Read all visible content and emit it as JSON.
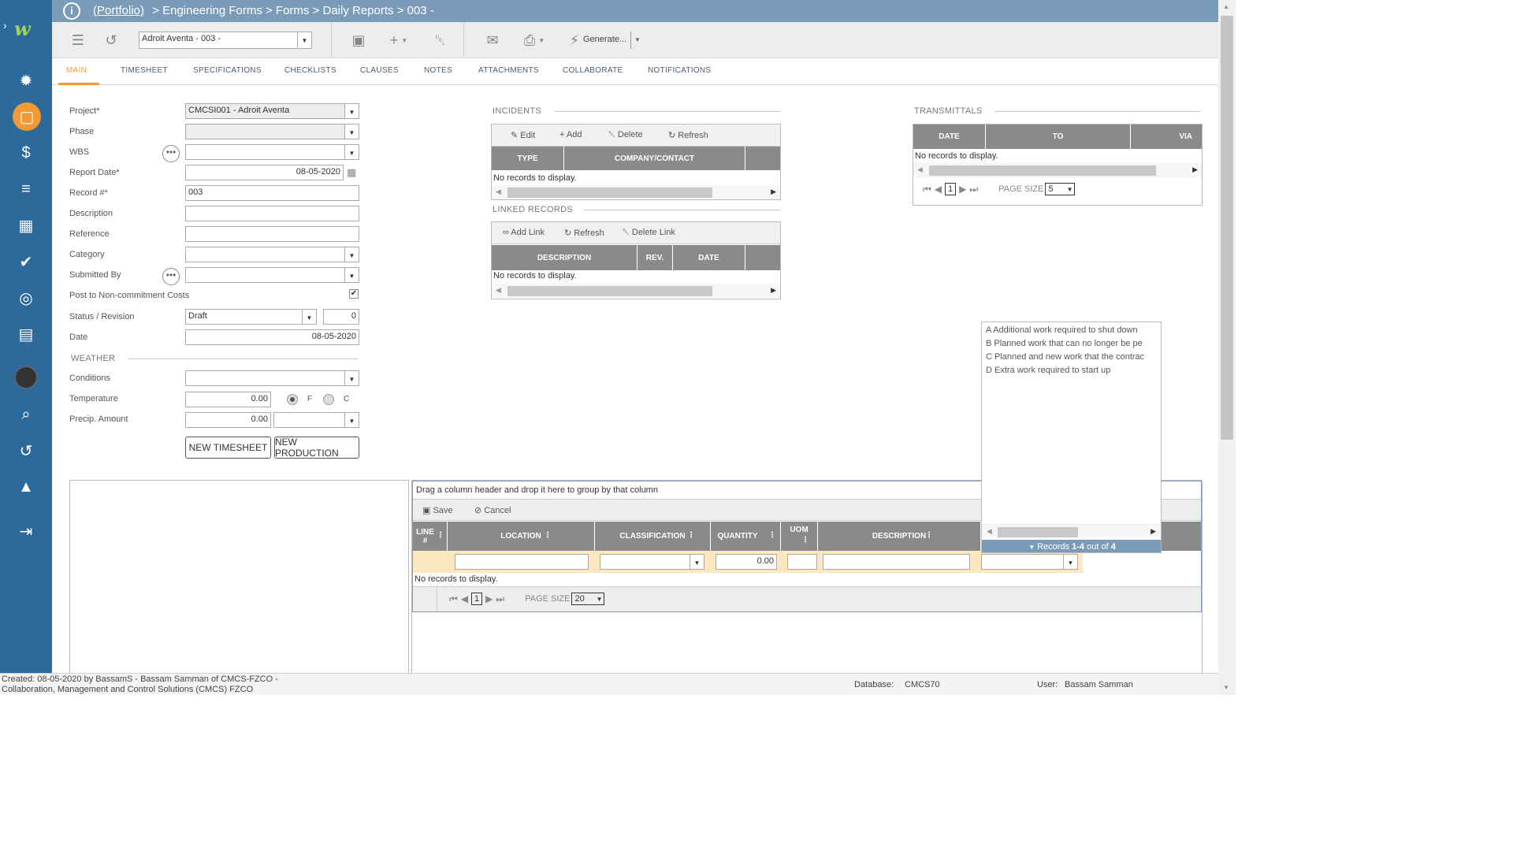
{
  "breadcrumb": {
    "portfolio": "(Portfolio)",
    "rest": " > Engineering Forms > Forms > Daily Reports > 003 -"
  },
  "toolbar": {
    "record_select": "Adroit Aventa - 003 -",
    "generate": "Generate..."
  },
  "tabs": [
    "MAIN",
    "TIMESHEET",
    "SPECIFICATIONS",
    "CHECKLISTS",
    "CLAUSES",
    "NOTES",
    "ATTACHMENTS",
    "COLLABORATE",
    "NOTIFICATIONS"
  ],
  "form": {
    "project_label": "Project*",
    "project_value": "CMCSI001 - Adroit Aventa",
    "phase_label": "Phase",
    "wbs_label": "WBS",
    "report_date_label": "Report Date*",
    "report_date_value": "08-05-2020",
    "record_label": "Record #*",
    "record_value": "003",
    "description_label": "Description",
    "reference_label": "Reference",
    "category_label": "Category",
    "submitted_by_label": "Submitted By",
    "post_label": "Post to Non-commitment Costs",
    "status_label": "Status / Revision",
    "status_value": "Draft",
    "revision_value": "0",
    "date_label": "Date",
    "date_value": "08-05-2020",
    "weather_section": "WEATHER",
    "conditions_label": "Conditions",
    "temperature_label": "Temperature",
    "temperature_value": "0.00",
    "unit_f": "F",
    "unit_c": "C",
    "precip_label": "Precip. Amount",
    "precip_value": "0.00",
    "new_timesheet": "NEW TIMESHEET",
    "new_production": "NEW PRODUCTION"
  },
  "incidents": {
    "title": "INCIDENTS",
    "edit": "Edit",
    "add": "Add",
    "delete": "Delete",
    "refresh": "Refresh",
    "col_type": "TYPE",
    "col_company": "COMPANY/CONTACT",
    "empty": "No records to display."
  },
  "linked": {
    "title": "LINKED RECORDS",
    "add_link": "Add Link",
    "refresh": "Refresh",
    "delete_link": "Delete Link",
    "col_description": "DESCRIPTION",
    "col_rev": "REV.",
    "col_date": "DATE",
    "empty": "No records to display."
  },
  "transmittals": {
    "title": "TRANSMITTALS",
    "col_date": "DATE",
    "col_to": "TO",
    "col_via": "VIA",
    "empty": "No records to display.",
    "page_size_label": "PAGE SIZE",
    "page": "1",
    "page_size": "5"
  },
  "dropdown_list": {
    "items": [
      "A Additional work required to shut down",
      "B Planned work that can no longer be pe",
      "C Planned and new work that the contrac",
      "D Extra work required to start up"
    ],
    "footer_pre": "Records ",
    "footer_range": "1-4",
    "footer_post": " out of ",
    "footer_total": "4"
  },
  "lines": {
    "group_hint": "Drag a column header and drop it here to group by that column",
    "save": "Save",
    "cancel": "Cancel",
    "col_line": "LINE #",
    "col_location": "LOCATION",
    "col_classification": "CLASSIFICATION",
    "col_quantity": "QUANTITY",
    "col_uom": "UOM",
    "col_description": "DESCRIPTION",
    "quantity_value": "0.00",
    "empty": "No records to display.",
    "page_size_label": "PAGE SIZE",
    "page": "1",
    "page_size": "20"
  },
  "status": {
    "created": "Created:  08-05-2020 by BassamS - Bassam Samman of CMCS-FZCO -",
    "company": "Collaboration, Management and Control Solutions (CMCS) FZCO",
    "database_label": "Database:",
    "database_value": "CMCS70",
    "user_label": "User:",
    "user_value": "Bassam Samman"
  },
  "colors": {
    "sidebar": "#2d6a9c",
    "topbar": "#7a9cb8",
    "accent": "#f39a34",
    "grid_header": "#8a8a8a"
  }
}
